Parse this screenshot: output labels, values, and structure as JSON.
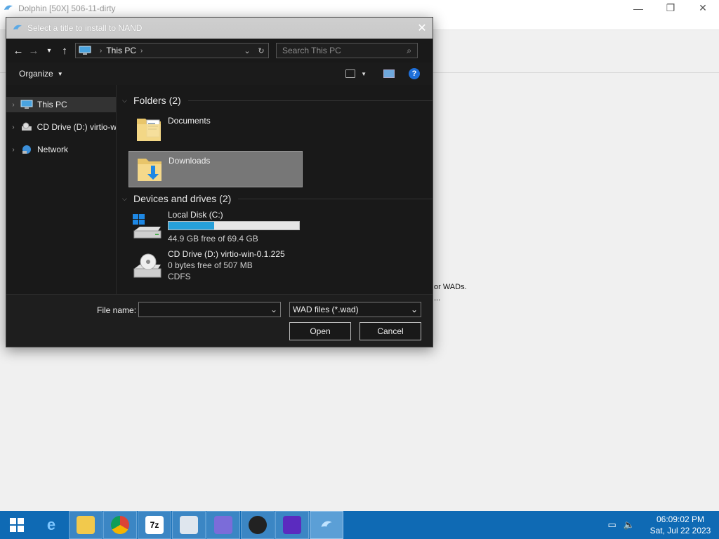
{
  "background_window": {
    "title": "Dolphin [50X] 506-11-dirty",
    "text_line1": "or WADs.",
    "text_line2": "..."
  },
  "dialog": {
    "title": "Select a title to install to NAND",
    "close_label": "✕",
    "address": {
      "location": "This PC"
    },
    "search": {
      "placeholder": "Search This PC"
    },
    "toolbar": {
      "organize_label": "Organize"
    },
    "sidebar": {
      "items": [
        {
          "label": "This PC",
          "icon": "computer-icon"
        },
        {
          "label": "CD Drive (D:) virtio-w",
          "icon": "cd-drive-icon"
        },
        {
          "label": "Network",
          "icon": "network-icon"
        }
      ]
    },
    "folders_header": "Folders (2)",
    "folders": [
      {
        "name": "Documents",
        "icon": "documents-folder-icon"
      },
      {
        "name": "Downloads",
        "icon": "downloads-folder-icon"
      }
    ],
    "drives_header": "Devices and drives (2)",
    "drives": [
      {
        "name": "Local Disk (C:)",
        "free_text": "44.9 GB free of 69.4 GB",
        "used_fraction": 0.35
      },
      {
        "name": "CD Drive (D:) virtio-win-0.1.225",
        "free_text": "0 bytes free of 507 MB",
        "fs": "CDFS"
      }
    ],
    "footer": {
      "filename_label": "File name:",
      "filename_value": "",
      "filter_value": "WAD files (*.wad)",
      "open_label": "Open",
      "cancel_label": "Cancel"
    }
  },
  "taskbar": {
    "apps": [
      "internet-explorer-icon",
      "file-explorer-icon",
      "chrome-icon",
      "7zip-icon",
      "printer-app-icon",
      "app-icon",
      "inkscape-icon",
      "game-icon",
      "dolphin-icon"
    ],
    "sevenzip_label": "7z",
    "time": "06:09:02 PM",
    "date": "Sat, Jul 22 2023"
  },
  "colors": {
    "taskbar": "#0f6ab4",
    "accent": "#26a0da",
    "dialog_bg": "#191919"
  }
}
